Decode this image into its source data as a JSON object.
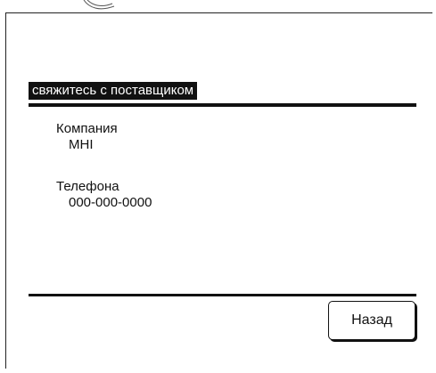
{
  "section": {
    "title": "свяжитесь с поставщиком"
  },
  "company": {
    "label": "Компания",
    "value": "MHI"
  },
  "phone": {
    "label": "Телефона",
    "value": "000-000-0000"
  },
  "actions": {
    "back_label": "Назад"
  }
}
